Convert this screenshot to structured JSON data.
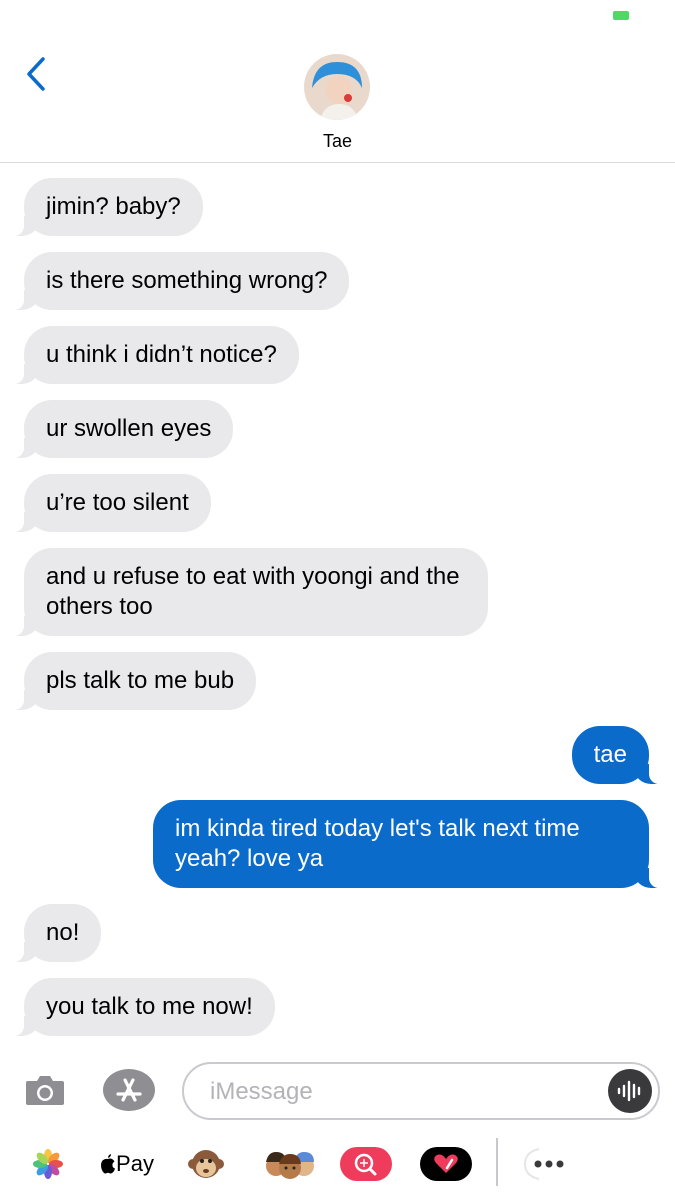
{
  "contact": {
    "name": "Tae"
  },
  "messages": [
    {
      "dir": "in",
      "text": "jimin? baby?"
    },
    {
      "dir": "in",
      "text": "is there something wrong?"
    },
    {
      "dir": "in",
      "text": "u think i didn’t notice?"
    },
    {
      "dir": "in",
      "text": "ur swollen eyes"
    },
    {
      "dir": "in",
      "text": "u’re too silent"
    },
    {
      "dir": "in",
      "text": "and u refuse to eat with yoongi and the others too"
    },
    {
      "dir": "in",
      "text": "pls talk to me bub"
    },
    {
      "dir": "out",
      "text": "tae"
    },
    {
      "dir": "out",
      "text": "im kinda tired today let's talk next time yeah? love ya"
    },
    {
      "dir": "in",
      "text": "no!"
    },
    {
      "dir": "in",
      "text": "you talk to me now!"
    }
  ],
  "compose": {
    "placeholder": "iMessage"
  },
  "app_drawer": {
    "apple_pay_label": "Pay",
    "apps": [
      "photos-icon",
      "apple-pay-icon",
      "monkey-memoji-icon",
      "memoji-stickers-icon",
      "images-search-icon",
      "digital-touch-icon",
      "more-apps-icon"
    ]
  },
  "colors": {
    "incoming_bubble": "#e9e9eb",
    "outgoing_bubble": "#0b6bcb",
    "accent": "#0b6bcb",
    "battery": "#4cd964"
  }
}
